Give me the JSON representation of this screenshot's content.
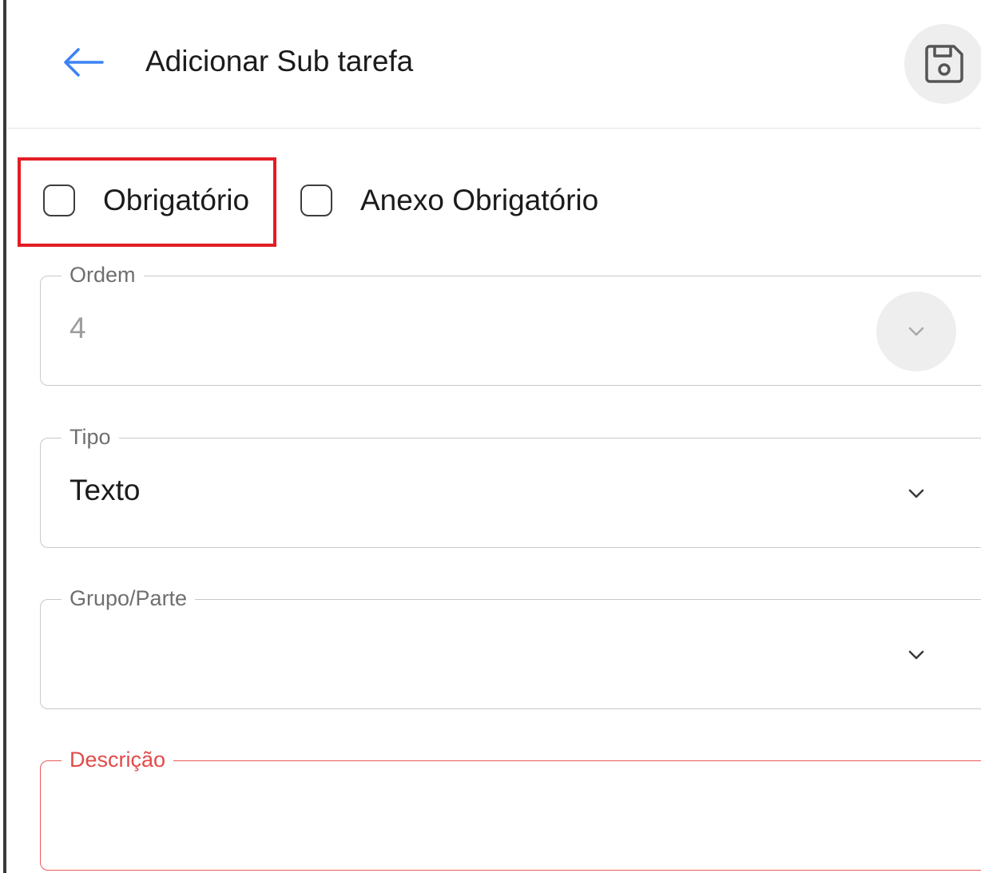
{
  "header": {
    "title": "Adicionar Sub tarefa",
    "back_icon": "arrow-left-icon",
    "save_icon": "floppy-disk-icon"
  },
  "checkboxes": [
    {
      "label": "Obrigatório",
      "checked": false,
      "highlighted": true
    },
    {
      "label": "Anexo Obrigatório",
      "checked": false,
      "highlighted": false
    }
  ],
  "fields": {
    "ordem": {
      "label": "Ordem",
      "value": "4",
      "disabled": true
    },
    "tipo": {
      "label": "Tipo",
      "value": "Texto"
    },
    "grupo": {
      "label": "Grupo/Parte",
      "value": ""
    },
    "descricao": {
      "label": "Descrição",
      "value": "",
      "state": "error"
    }
  },
  "colors": {
    "accent": "#3b82f6",
    "highlight": "#e31d24",
    "error": "#e34a4a"
  }
}
